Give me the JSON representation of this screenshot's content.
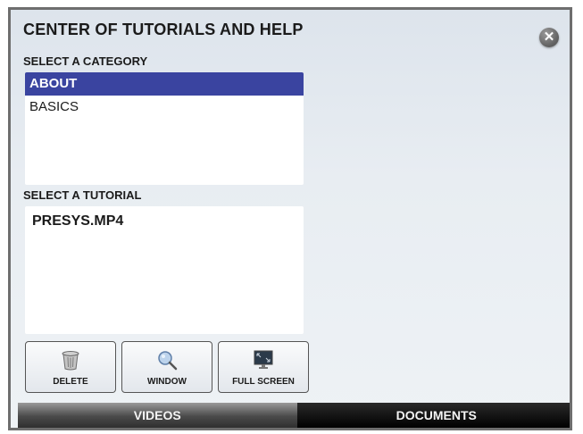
{
  "header": {
    "title": "CENTER OF TUTORIALS AND HELP",
    "close_icon": "close-icon"
  },
  "category_section": {
    "label": "SELECT A CATEGORY",
    "items": [
      {
        "label": "ABOUT",
        "selected": true
      },
      {
        "label": "BASICS",
        "selected": false
      }
    ]
  },
  "tutorial_section": {
    "label": "SELECT A TUTORIAL",
    "items": [
      {
        "label": "PRESYS.MP4"
      }
    ]
  },
  "toolbar": {
    "delete": {
      "label": "DELETE",
      "icon": "trash-icon"
    },
    "window": {
      "label": "WINDOW",
      "icon": "magnifier-icon"
    },
    "full_screen": {
      "label": "FULL SCREEN",
      "icon": "monitor-icon"
    }
  },
  "tabs": [
    {
      "label": "VIDEOS",
      "active": true
    },
    {
      "label": "DOCUMENTS",
      "active": false
    }
  ],
  "colors": {
    "selection": "#3a44a0",
    "panel_background": "#e8edf2",
    "frame_border": "#6e6e6e"
  }
}
